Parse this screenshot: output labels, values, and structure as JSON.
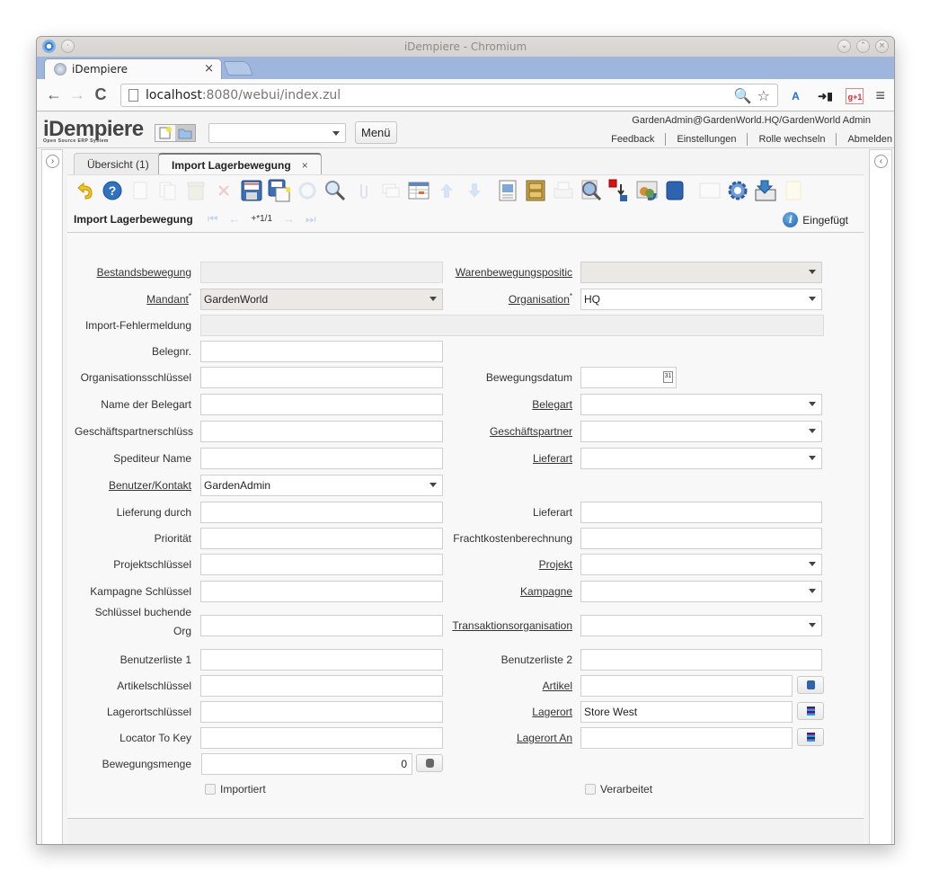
{
  "browser": {
    "window_title": "iDempiere - Chromium",
    "tab_title": "iDempiere",
    "url_host": "localhost",
    "url_path": ":8080/webui/index.zul"
  },
  "app": {
    "logo_text": "iDempiere",
    "logo_subtitle": "Open Source ERP System",
    "menu_button": "Menü",
    "search_select_value": "",
    "user_info": "GardenAdmin@GardenWorld.HQ/GardenWorld Admin",
    "header_links": [
      "Feedback",
      "Einstellungen",
      "Rolle wechseln",
      "Abmelden"
    ]
  },
  "tabs": [
    {
      "label": "Übersicht (1)",
      "active": false
    },
    {
      "label": "Import Lagerbewegung",
      "active": true,
      "close": "×"
    }
  ],
  "window": {
    "title": "Import Lagerbewegung",
    "record_count": "+*1/1",
    "status_text": "Eingefügt"
  },
  "toolbar": {
    "icons": [
      "undo-icon",
      "help-icon",
      "new-record-icon",
      "copy-record-icon",
      "delete-icon",
      "delete-selection-icon",
      "save-icon",
      "save-and-new-icon",
      "refresh-icon",
      "find-icon",
      "attachment-icon",
      "chat-icon",
      "grid-toggle-icon",
      "parent-record-icon",
      "detail-record-icon",
      "report-icon",
      "archive-icon",
      "print-icon",
      "zoom-across-icon",
      "active-workflows-icon",
      "requests-icon",
      "product-info-icon",
      "post-icon",
      "process-icon",
      "export-icon",
      "customize-icon"
    ]
  },
  "form": {
    "left": [
      {
        "label": "Bestandsbewegung",
        "value": "",
        "type": "readonly",
        "link": true
      },
      {
        "label": "Mandant",
        "value": "GardenWorld",
        "type": "select-readonly",
        "link": true,
        "required": true
      },
      {
        "label": "Import-Fehlermeldung",
        "value": "",
        "type": "readonly-full",
        "link": false
      },
      {
        "label": "Belegnr.",
        "value": "",
        "type": "text",
        "link": false
      },
      {
        "label": "Organisationsschlüssel",
        "value": "",
        "type": "text",
        "link": false
      },
      {
        "label": "Name der Belegart",
        "value": "",
        "type": "text",
        "link": false
      },
      {
        "label": "Geschäftspartnerschlüss",
        "value": "",
        "type": "text",
        "link": false
      },
      {
        "label": "Spediteur Name",
        "value": "",
        "type": "text",
        "link": false
      },
      {
        "label": "Benutzer/Kontakt",
        "value": "GardenAdmin",
        "type": "select",
        "link": true
      },
      {
        "label": "Lieferung durch",
        "value": "",
        "type": "text",
        "link": false
      },
      {
        "label": "Priorität",
        "value": "",
        "type": "text",
        "link": false
      },
      {
        "label": "Projektschlüssel",
        "value": "",
        "type": "text",
        "link": false
      },
      {
        "label": "Kampagne Schlüssel",
        "value": "",
        "type": "text",
        "link": false
      },
      {
        "label_line1": "Schlüssel buchende",
        "label_line2": "Org",
        "value": "",
        "type": "text",
        "link": false
      },
      {
        "label": "Benutzerliste 1",
        "value": "",
        "type": "text",
        "link": false
      },
      {
        "label": "Artikelschlüssel",
        "value": "",
        "type": "text",
        "link": false
      },
      {
        "label": "Lagerortschlüssel",
        "value": "",
        "type": "text",
        "link": false
      },
      {
        "label": "Locator To Key",
        "value": "",
        "type": "text",
        "link": false
      },
      {
        "label": "Bewegungsmenge",
        "value": "0",
        "type": "number",
        "link": false
      }
    ],
    "right": [
      {
        "label": "Warenbewegungspositic",
        "value": "",
        "type": "select-readonly",
        "link": true
      },
      {
        "label": "Organisation",
        "value": "HQ",
        "type": "select",
        "link": true,
        "required": true
      },
      {
        "label": "Bewegungsdatum",
        "value": "",
        "type": "date",
        "link": false,
        "calendar_day": "31"
      },
      {
        "label": "Belegart",
        "value": "",
        "type": "select",
        "link": true
      },
      {
        "label": "Geschäftspartner",
        "value": "",
        "type": "select",
        "link": true
      },
      {
        "label": "Lieferart",
        "value": "",
        "type": "select",
        "link": true
      },
      {
        "label": "Lieferart",
        "value": "",
        "type": "text",
        "link": false
      },
      {
        "label": "Frachtkostenberechnung",
        "value": "",
        "type": "text",
        "link": false
      },
      {
        "label": "Projekt",
        "value": "",
        "type": "select",
        "link": true
      },
      {
        "label": "Kampagne",
        "value": "",
        "type": "select",
        "link": true
      },
      {
        "label": "Transaktionsorganisation",
        "value": "",
        "type": "select",
        "link": true
      },
      {
        "label": "Benutzerliste 2",
        "value": "",
        "type": "text",
        "link": false
      },
      {
        "label": "Artikel",
        "value": "",
        "type": "search",
        "link": true
      },
      {
        "label": "Lagerort",
        "value": "Store West",
        "type": "search",
        "link": true
      },
      {
        "label": "Lagerort An",
        "value": "",
        "type": "search",
        "link": true
      }
    ],
    "checkboxes": [
      {
        "label": "Importiert",
        "checked": false
      },
      {
        "label": "Verarbeitet",
        "checked": false
      }
    ]
  }
}
